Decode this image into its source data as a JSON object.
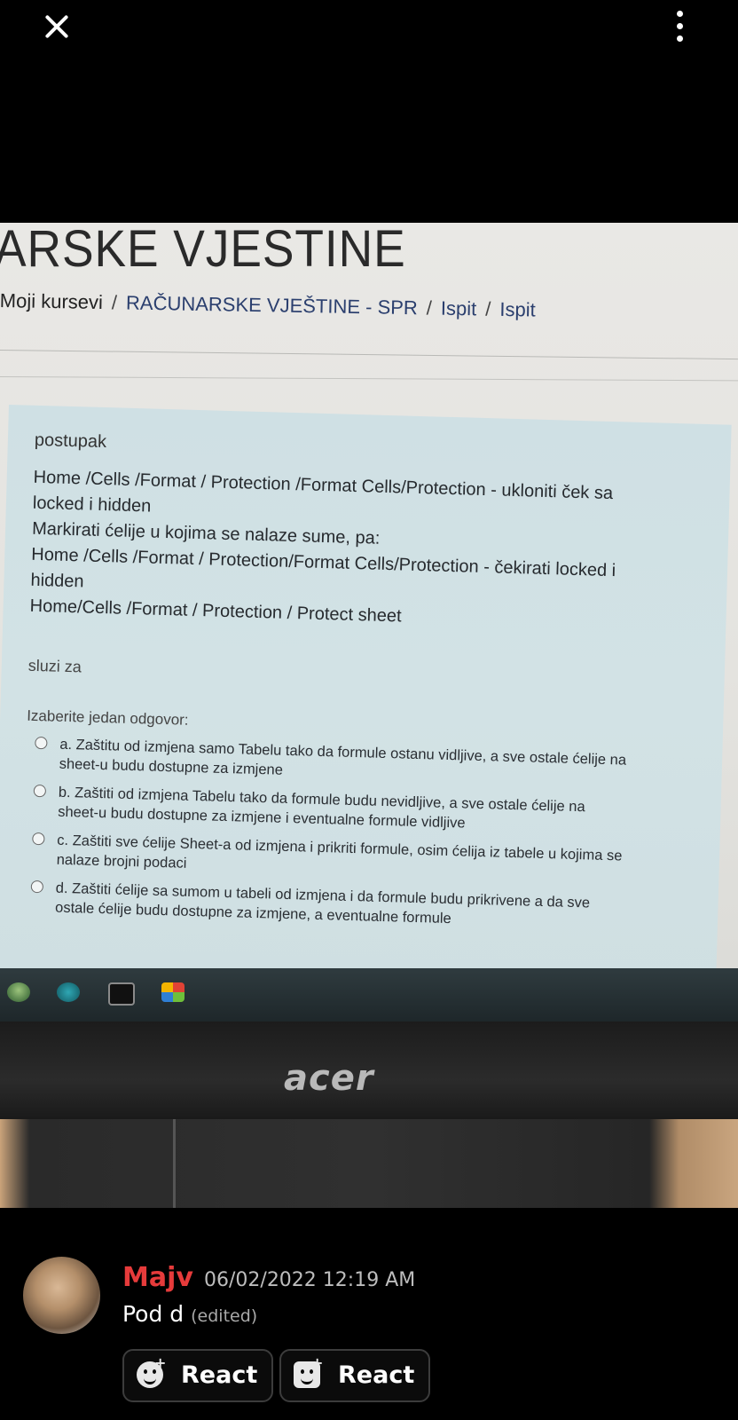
{
  "viewer": {
    "close_icon": "close-icon",
    "more_icon": "more-vertical-icon"
  },
  "photo": {
    "course_title": "ARSKE VJESTINE",
    "breadcrumb": {
      "items": [
        "Moji kursevi",
        "RAČUNARSKE VJEŠTINE - SPR",
        "Ispit",
        "Ispit"
      ],
      "separator": "/"
    },
    "question": {
      "label": "postupak",
      "steps": [
        "Home /Cells /Format / Protection /Format Cells/Protection - ukloniti ček sa locked i hidden",
        "Markirati ćelije u kojima se nalaze sume, pa:",
        "Home /Cells /Format / Protection/Format Cells/Protection - čekirati locked i hidden",
        "Home/Cells /Format / Protection / Protect sheet"
      ],
      "purpose": "sluzi za",
      "prompt": "Izaberite jedan odgovor:",
      "options": [
        "a.  Zaštitu od izmjena samo Tabelu  tako da formule ostanu vidljive, a sve ostale ćelije na sheet-u budu dostupne za izmjene",
        "b. Zaštiti od izmjena Tabelu  tako da formule budu nevidljive, a sve ostale ćelije na sheet-u budu dostupne za izmjene i eventualne formule vidljive",
        "c.  Zaštiti sve ćelije Sheet-a od izmjena i prikriti formule, osim ćelija iz tabele u kojima se nalaze brojni podaci",
        "d. Zaštiti ćelije sa sumom u tabeli od izmjena i da formule budu prikrivene a da sve ostale ćelije budu dostupne za izmjene, a eventualne formule"
      ]
    },
    "monitor_brand": "acer",
    "taskbar_icons": [
      "chat-icon",
      "arduino-icon",
      "terminal-icon",
      "windows-icon"
    ]
  },
  "message": {
    "username": "Majv",
    "username_color": "#e63b3b",
    "timestamp": "06/02/2022 12:19 AM",
    "text": "Pod d",
    "edited_label": "(edited)",
    "react_buttons": [
      {
        "label": "React",
        "icon": "add-reaction-icon"
      },
      {
        "label": "React",
        "icon": "add-super-reaction-icon"
      }
    ]
  }
}
